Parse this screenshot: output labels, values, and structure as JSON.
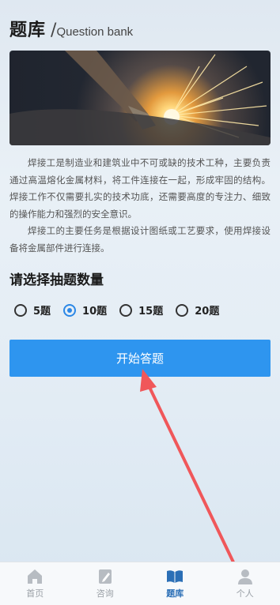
{
  "header": {
    "title": "题库",
    "slash": "/",
    "subtitle": "Question bank"
  },
  "intro": {
    "p1": "焊接工是制造业和建筑业中不可或缺的技术工种，主要负责通过高温熔化金属材料，将工件连接在一起，形成牢固的结构。焊接工作不仅需要扎实的技术功底，还需要高度的专注力、细致的操作能力和强烈的安全意识。",
    "p2": "焊接工的主要任务是根据设计图纸或工艺要求，使用焊接设备将金属部件进行连接。"
  },
  "select": {
    "title": "请选择抽题数量",
    "options": [
      {
        "label": "5题",
        "checked": false
      },
      {
        "label": "10题",
        "checked": true
      },
      {
        "label": "15题",
        "checked": false
      },
      {
        "label": "20题",
        "checked": false
      }
    ]
  },
  "start_button": {
    "label": "开始答题"
  },
  "tabbar": {
    "tabs": [
      {
        "label": "首页",
        "icon": "home-icon"
      },
      {
        "label": "咨询",
        "icon": "edit-icon"
      },
      {
        "label": "题库",
        "icon": "book-icon",
        "active": true
      },
      {
        "label": "个人",
        "icon": "user-icon"
      }
    ]
  },
  "colors": {
    "accent": "#2e95ef",
    "arrow": "#f0575a",
    "active_tab": "#2b6fb6"
  }
}
